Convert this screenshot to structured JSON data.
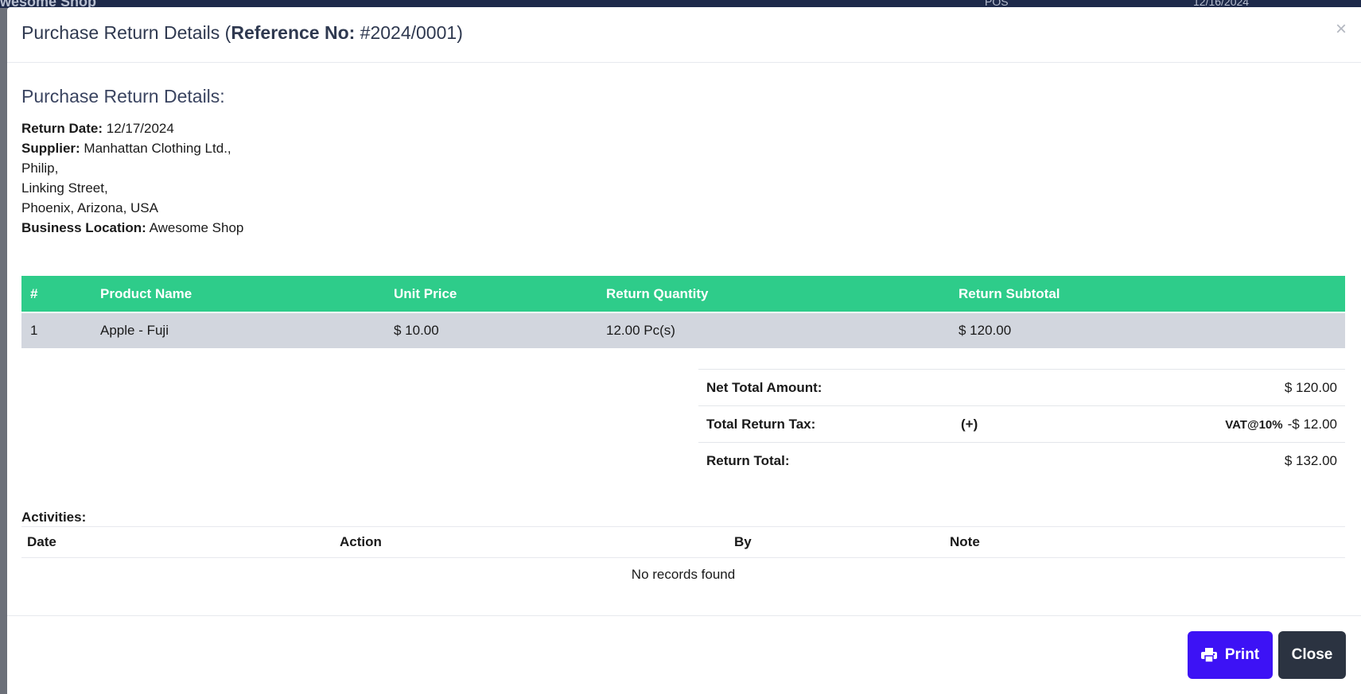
{
  "background": {
    "brand": "wesome Shop",
    "topbar_date": "12/16/2024",
    "topbar_pos": "POS"
  },
  "modal": {
    "title_prefix": "Purchase Return Details (",
    "ref_label": "Reference No:",
    "ref_value": "#2024/0001",
    "title_suffix": ")",
    "close_symbol": "×"
  },
  "details": {
    "heading": "Purchase Return Details:",
    "return_date_label": "Return Date:",
    "return_date": "12/17/2024",
    "supplier_label": "Supplier:",
    "supplier_name": "Manhattan Clothing Ltd.,",
    "supplier_contact": "Philip,",
    "supplier_street": "Linking Street,",
    "supplier_city": "Phoenix, Arizona, USA",
    "location_label": "Business Location:",
    "location": "Awesome Shop"
  },
  "products": {
    "columns": [
      "#",
      "Product Name",
      "Unit Price",
      "Return Quantity",
      "Return Subtotal"
    ],
    "rows": [
      [
        "1",
        "Apple - Fuji",
        "$ 10.00",
        "12.00 Pc(s)",
        "$ 120.00"
      ]
    ]
  },
  "totals": {
    "net_label": "Net Total Amount:",
    "net_value": "$ 120.00",
    "tax_label": "Total Return Tax:",
    "tax_sign": "(+)",
    "tax_name": "VAT@10%",
    "tax_value": "-$ 12.00",
    "total_label": "Return Total:",
    "total_value": "$ 132.00"
  },
  "activities": {
    "title": "Activities:",
    "columns": [
      "Date",
      "Action",
      "By",
      "Note"
    ],
    "empty": "No records found"
  },
  "buttons": {
    "print": "Print",
    "close": "Close"
  },
  "colors": {
    "table_header": "#2ecc8a",
    "print_button": "#3d12f5",
    "close_button": "#2b3341"
  }
}
